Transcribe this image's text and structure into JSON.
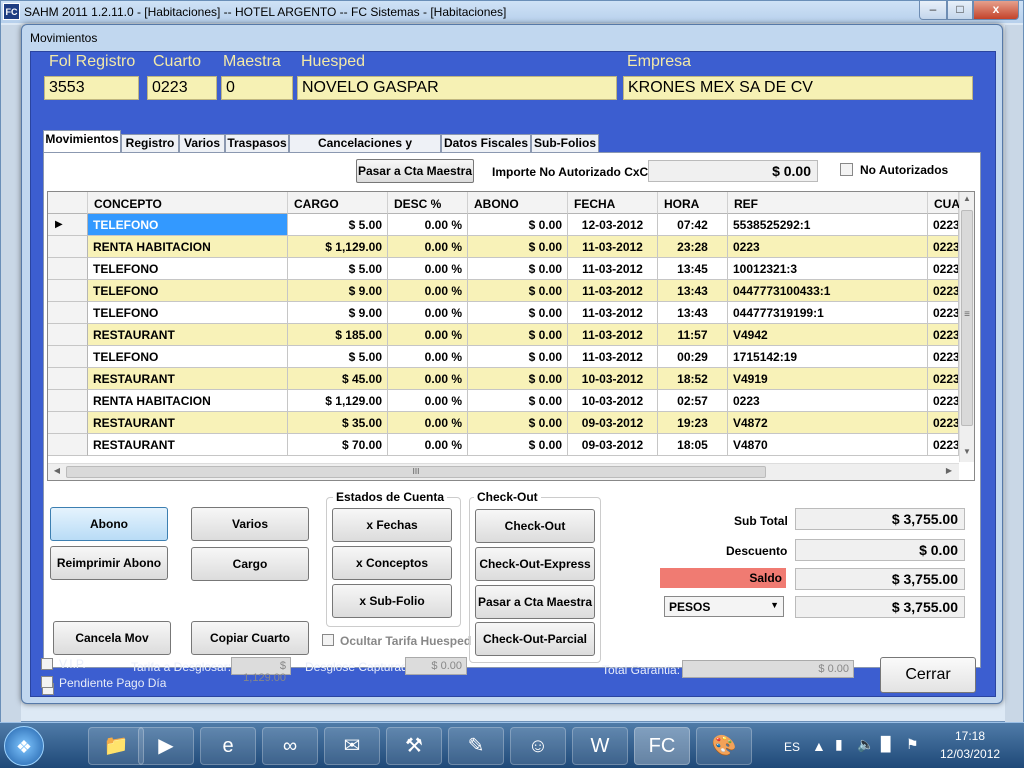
{
  "main_window": {
    "title": "SAHM 2011 1.2.11.0 - [Habitaciones]  -- HOTEL ARGENTO -- FC Sistemas - [Habitaciones]",
    "app_icon": "FC",
    "min_label": "–",
    "max_label": "□",
    "close_label": "x"
  },
  "dialog": {
    "title": "Movimientos",
    "header": {
      "folio_label": "Fol Registro",
      "folio_value": "3553",
      "room_label": "Cuarto",
      "room_value": "0223",
      "master_label": "Maestra",
      "master_value": "0",
      "guest_label": "Huesped",
      "guest_value": "NOVELO  GASPAR",
      "company_label": "Empresa",
      "company_value": "KRONES MEX SA DE CV"
    },
    "tabs": [
      "Movimientos",
      "Registro",
      "Varios",
      "Traspasos",
      "Cancelaciones y Garantias",
      "Datos Fiscales",
      "Sub-Folios"
    ],
    "pasar_maestra_button": "Pasar a Cta Maestra",
    "importe_label": "Importe No Autorizado CxC",
    "importe_value": "$ 0.00",
    "no_autorizados_label": "No Autorizados",
    "grid": {
      "columns": [
        "CONCEPTO",
        "CARGO",
        "DESC %",
        "ABONO",
        "FECHA",
        "HORA",
        "REF",
        "CUA"
      ],
      "rows": [
        {
          "concepto": "TELEFONO",
          "cargo": "$ 5.00",
          "desc": "0.00 %",
          "abono": "$ 0.00",
          "fecha": "12-03-2012",
          "hora": "07:42",
          "ref": "5538525292:1",
          "cuarto": "0223"
        },
        {
          "concepto": "RENTA HABITACION",
          "cargo": "$ 1,129.00",
          "desc": "0.00 %",
          "abono": "$ 0.00",
          "fecha": "11-03-2012",
          "hora": "23:28",
          "ref": "0223",
          "cuarto": "0223"
        },
        {
          "concepto": "TELEFONO",
          "cargo": "$ 5.00",
          "desc": "0.00 %",
          "abono": "$ 0.00",
          "fecha": "11-03-2012",
          "hora": "13:45",
          "ref": "10012321:3",
          "cuarto": "0223"
        },
        {
          "concepto": "TELEFONO",
          "cargo": "$ 9.00",
          "desc": "0.00 %",
          "abono": "$ 0.00",
          "fecha": "11-03-2012",
          "hora": "13:43",
          "ref": "0447773100433:1",
          "cuarto": "0223"
        },
        {
          "concepto": "TELEFONO",
          "cargo": "$ 9.00",
          "desc": "0.00 %",
          "abono": "$ 0.00",
          "fecha": "11-03-2012",
          "hora": "13:43",
          "ref": "044777319199:1",
          "cuarto": "0223"
        },
        {
          "concepto": "RESTAURANT",
          "cargo": "$ 185.00",
          "desc": "0.00 %",
          "abono": "$ 0.00",
          "fecha": "11-03-2012",
          "hora": "11:57",
          "ref": "V4942",
          "cuarto": "0223"
        },
        {
          "concepto": "TELEFONO",
          "cargo": "$ 5.00",
          "desc": "0.00 %",
          "abono": "$ 0.00",
          "fecha": "11-03-2012",
          "hora": "00:29",
          "ref": "1715142:19",
          "cuarto": "0223"
        },
        {
          "concepto": "RESTAURANT",
          "cargo": "$ 45.00",
          "desc": "0.00 %",
          "abono": "$ 0.00",
          "fecha": "10-03-2012",
          "hora": "18:52",
          "ref": "V4919",
          "cuarto": "0223"
        },
        {
          "concepto": "RENTA HABITACION",
          "cargo": "$ 1,129.00",
          "desc": "0.00 %",
          "abono": "$ 0.00",
          "fecha": "10-03-2012",
          "hora": "02:57",
          "ref": "0223",
          "cuarto": "0223"
        },
        {
          "concepto": "RESTAURANT",
          "cargo": "$ 35.00",
          "desc": "0.00 %",
          "abono": "$ 0.00",
          "fecha": "09-03-2012",
          "hora": "19:23",
          "ref": "V4872",
          "cuarto": "0223"
        },
        {
          "concepto": "RESTAURANT",
          "cargo": "$ 70.00",
          "desc": "0.00 %",
          "abono": "$ 0.00",
          "fecha": "09-03-2012",
          "hora": "18:05",
          "ref": "V4870",
          "cuarto": "0223"
        }
      ],
      "current_row_marker": "▶",
      "hscroll_grip": "III",
      "vscroll_grip": "≡"
    },
    "buttons": {
      "abono": "Abono",
      "varios": "Varios",
      "reimprimir_abono": "Reimprimir Abono",
      "cargo": "Cargo",
      "cancela_mov": "Cancela Mov",
      "copiar_cuarto": "Copiar Cuarto"
    },
    "estados_cuenta": {
      "title": "Estados de Cuenta",
      "x_fechas": "x Fechas",
      "x_conceptos": "x Conceptos",
      "x_subfolio": "x Sub-Folio"
    },
    "ocultar_tarifa_label": "Ocultar Tarifa Huesped",
    "checkout": {
      "title": "Check-Out",
      "checkout": "Check-Out",
      "express": "Check-Out-Express",
      "pasar_maestra": "Pasar a Cta Maestra",
      "parcial": "Check-Out-Parcial"
    },
    "totals": {
      "subtotal_label": "Sub Total",
      "subtotal_value": "$ 3,755.00",
      "descuento_label": "Descuento",
      "descuento_value": "$ 0.00",
      "saldo_label": "Saldo",
      "saldo_value": "$ 3,755.00",
      "currency_selected": "PESOS",
      "currency_value": "$ 3,755.00"
    },
    "footer": {
      "vip_label": "V.I.P.",
      "pendiente_label": "Pendiente Pago Día",
      "tarifa_label": "Tarifa a Desglosar:",
      "tarifa_value": "$ 1,129.00",
      "desglose_label": "Desglose Capturado:",
      "desglose_value": "$ 0.00",
      "garantia_label": "Total Garantia:",
      "garantia_value": "$ 0.00",
      "cerrar_button": "Cerrar"
    }
  },
  "taskbar": {
    "lang": "ES",
    "time": "17:18",
    "date": "12/03/2012"
  },
  "colors": {
    "row_alt": "#f8f2b8",
    "row_selected": "#3399ff",
    "saldo_bg": "#f07b72",
    "dialog_blue": "#3c5ed0",
    "header_label": "#f3e9a8"
  }
}
